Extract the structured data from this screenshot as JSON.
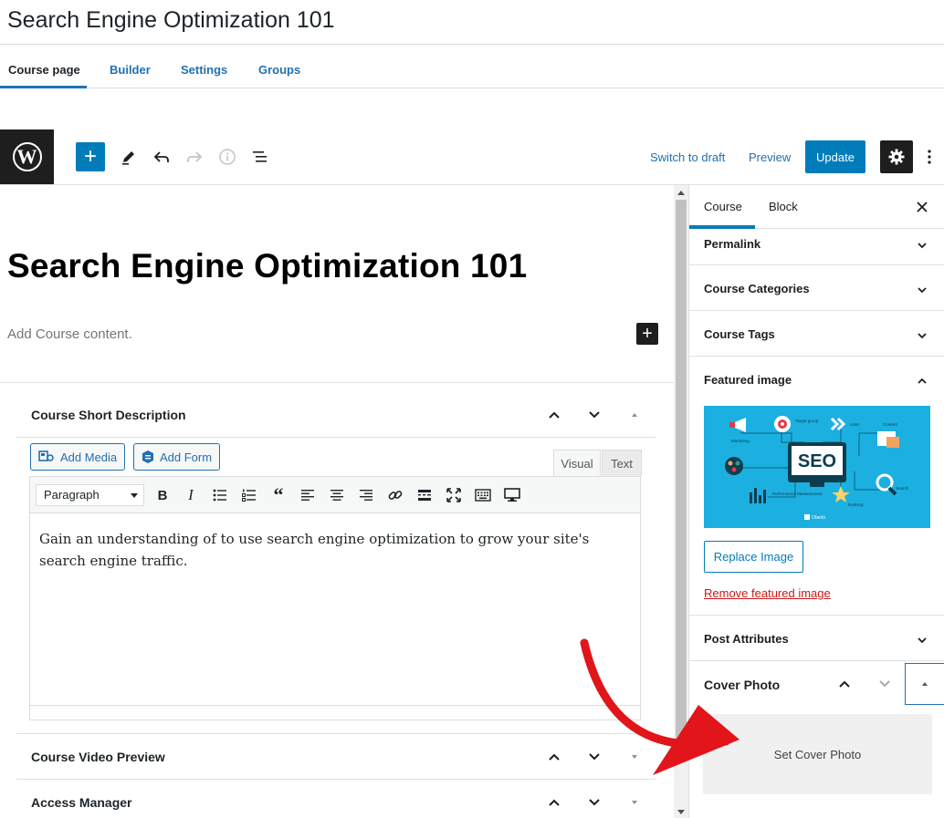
{
  "page": {
    "title": "Search Engine Optimization 101"
  },
  "course_tabs": [
    {
      "label": "Course page",
      "active": true
    },
    {
      "label": "Builder",
      "active": false
    },
    {
      "label": "Settings",
      "active": false
    },
    {
      "label": "Groups",
      "active": false
    }
  ],
  "toolbar": {
    "logo": "W",
    "add_block": "+",
    "switch_to_draft": "Switch to draft",
    "preview": "Preview",
    "update": "Update",
    "icons": [
      "wordpress-logo-icon",
      "plus-icon",
      "pencil-icon",
      "undo-icon",
      "redo-icon",
      "info-icon",
      "list-view-icon",
      "gear-icon",
      "more-vertical-icon"
    ]
  },
  "editor": {
    "post_title": "Search Engine Optimization 101",
    "content_placeholder": "Add Course content.",
    "inline_add": "+"
  },
  "metaboxes": {
    "short_description": {
      "title": "Course Short Description",
      "add_media": "Add Media",
      "add_form": "Add Form",
      "tab_visual": "Visual",
      "tab_text": "Text",
      "format": "Paragraph",
      "body": "Gain an understanding of to use search engine optimization to grow your site's search engine traffic."
    },
    "video_preview": {
      "title": "Course Video Preview"
    },
    "access_manager": {
      "title": "Access Manager"
    }
  },
  "sidebar": {
    "tabs": [
      {
        "label": "Course",
        "active": true
      },
      {
        "label": "Block",
        "active": false
      }
    ],
    "panels": {
      "permalink": "Permalink",
      "categories": "Course Categories",
      "tags": "Course Tags",
      "featured_image": "Featured image",
      "post_attributes": "Post Attributes"
    },
    "featured_image": {
      "replace": "Replace Image",
      "remove": "Remove featured image",
      "seo_label": "SEO",
      "labels": [
        "Marketing",
        "Target group",
        "Links",
        "Content",
        "Performance Measurement",
        "Ranking",
        "Search",
        "Oberlo"
      ]
    },
    "cover_photo": {
      "title": "Cover Photo",
      "set_label": "Set Cover Photo"
    }
  },
  "colors": {
    "primary": "#007cba",
    "link": "#2271b1",
    "dark": "#1e1e1e",
    "danger": "#cc1818",
    "annotation_arrow": "#e1151a",
    "featured_bg": "#1cb0e0"
  }
}
